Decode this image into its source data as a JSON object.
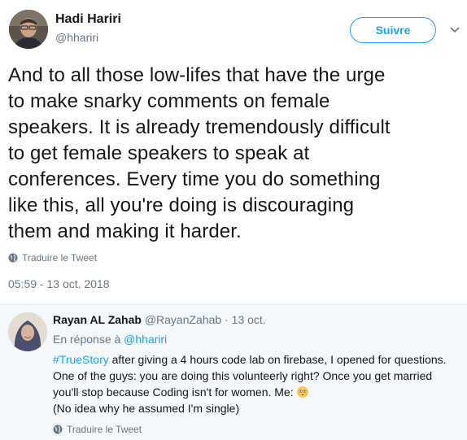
{
  "author": {
    "name": "Hadi Hariri",
    "handle": "@hhariri",
    "follow_label": "Suivre"
  },
  "tweet": {
    "text": "And to all those low-lifes that have the urge\nto make snarky comments on female\nspeakers. It is already tremendously difficult\nto get female speakers to speak at\nconferences. Every time you do something\nlike this, all you're doing is discouraging\nthem and making it harder.",
    "translate_label": "Traduire le Tweet",
    "timestamp": "05:59 - 13 oct. 2018"
  },
  "reply": {
    "name": "Rayan AL Zahab",
    "handle": "@RayanZahab",
    "separator": " · ",
    "date": "13 oct.",
    "in_reply_prefix": "En réponse à ",
    "in_reply_mention": "@hhariri",
    "hashtag": "#TrueStory",
    "line1_rest": " after giving a 4 hours code lab on firebase, I opened for questions.",
    "line2": "One of the guys: you are doing this volunteerly right? Once you get married",
    "line3": "you'll stop because Coding isn't for women. Me: ",
    "line4": "(No idea why he assumed I'm single)",
    "emoji": "flushed-face",
    "translate_label": "Traduire le Tweet"
  },
  "colors": {
    "accent": "#1da1f2",
    "secondary_text": "#657786",
    "reply_background": "#f5f8fa"
  }
}
